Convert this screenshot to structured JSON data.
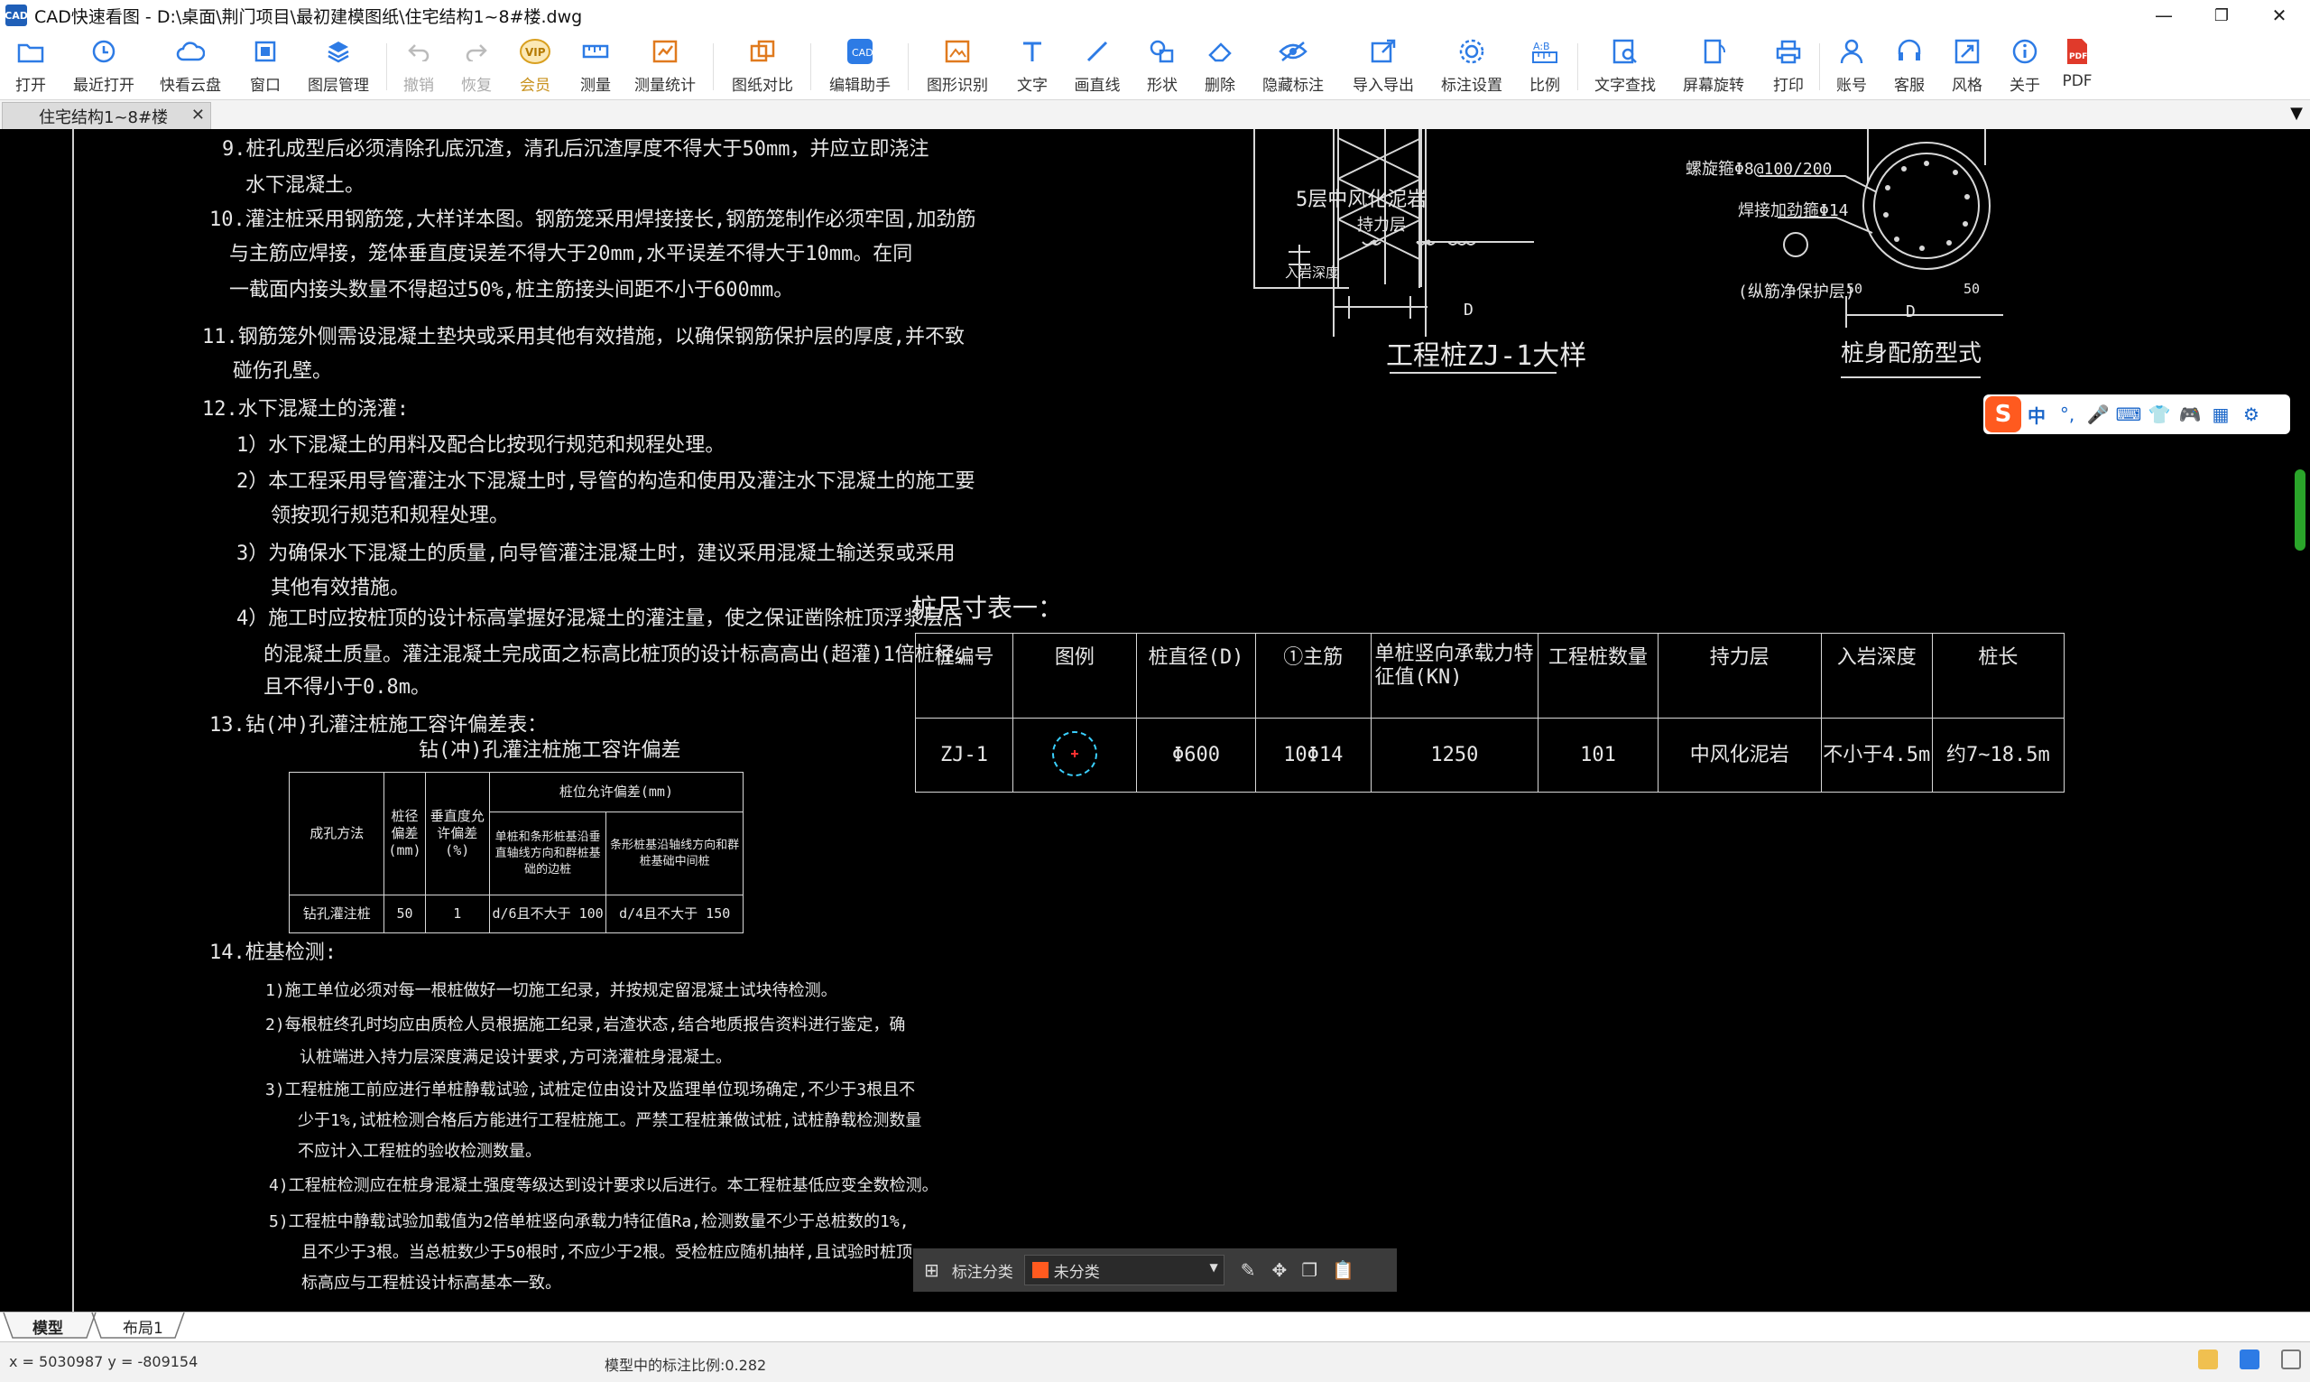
{
  "window": {
    "logo_text": "CAD",
    "title": "CAD快速看图 - D:\\桌面\\荆门项目\\最初建模图纸\\住宅结构1~8#楼.dwg",
    "minimize": "—",
    "maximize": "❐",
    "close": "✕"
  },
  "toolbar": {
    "items": [
      {
        "label": "打开",
        "icon": "folder-open-icon"
      },
      {
        "label": "最近打开",
        "icon": "clock-icon"
      },
      {
        "label": "快看云盘",
        "icon": "cloud-icon"
      },
      {
        "label": "窗口",
        "icon": "window-icon"
      },
      {
        "label": "图层管理",
        "icon": "layers-icon"
      },
      {
        "label": "撤销",
        "icon": "undo-icon",
        "disabled": true
      },
      {
        "label": "恢复",
        "icon": "redo-icon",
        "disabled": true
      },
      {
        "label": "会员",
        "icon": "vip-icon"
      },
      {
        "label": "测量",
        "icon": "ruler-icon"
      },
      {
        "label": "测量统计",
        "icon": "measure-stats-icon"
      },
      {
        "label": "图纸对比",
        "icon": "compare-icon"
      },
      {
        "label": "编辑助手",
        "icon": "edit-assistant-icon"
      },
      {
        "label": "图形识别",
        "icon": "shape-recognize-icon"
      },
      {
        "label": "文字",
        "icon": "text-icon"
      },
      {
        "label": "画直线",
        "icon": "line-icon"
      },
      {
        "label": "形状",
        "icon": "shape-icon"
      },
      {
        "label": "删除",
        "icon": "eraser-icon"
      },
      {
        "label": "隐藏标注",
        "icon": "hide-annotation-icon"
      },
      {
        "label": "导入导出",
        "icon": "import-export-icon"
      },
      {
        "label": "标注设置",
        "icon": "annotation-settings-icon"
      },
      {
        "label": "比例",
        "icon": "scale-icon"
      },
      {
        "label": "文字查找",
        "icon": "text-search-icon"
      },
      {
        "label": "屏幕旋转",
        "icon": "rotate-screen-icon"
      },
      {
        "label": "打印",
        "icon": "printer-icon"
      },
      {
        "label": "账号",
        "icon": "user-icon"
      },
      {
        "label": "客服",
        "icon": "headset-icon"
      },
      {
        "label": "风格",
        "icon": "style-icon"
      },
      {
        "label": "关于",
        "icon": "info-icon"
      },
      {
        "label": "PDF",
        "icon": "pdf-icon"
      }
    ]
  },
  "tabs": {
    "doc_tab": "住宅结构1~8#楼",
    "close": "✕",
    "dropdown": "▼"
  },
  "drawing": {
    "notes": [
      "9.桩孔成型后必须清除孔底沉渣，清孔后沉渣厚度不得大于50mm，并应立即浇注",
      "水下混凝土。",
      "10.灌注桩采用钢筋笼,大样详本图。钢筋笼采用焊接接长,钢筋笼制作必须牢固,加劲筋",
      "与主筋应焊接，笼体垂直度误差不得大于20mm,水平误差不得大于10mm。在同",
      "一截面内接头数量不得超过50%,桩主筋接头间距不小于600mm。",
      "11.钢筋笼外侧需设混凝土垫块或采用其他有效措施，以确保钢筋保护层的厚度,并不致",
      "碰伤孔壁。",
      "12.水下混凝土的浇灌:",
      "1）水下混凝土的用料及配合比按现行规范和规程处理。",
      "2）本工程采用导管灌注水下混凝土时,导管的构造和使用及灌注水下混凝土的施工要",
      "领按现行规范和规程处理。",
      "3）为确保水下混凝土的质量,向导管灌注混凝土时，建议采用混凝土输送泵或采用",
      "其他有效措施。",
      "4）施工时应按桩顶的设计标高掌握好混凝土的灌注量，使之保证凿除桩顶浮浆层后",
      "的混凝土质量。灌注混凝土完成面之标高比桩顶的设计标高高出(超灌)1倍桩径,",
      "且不得小于0.8m。",
      "13.钻(冲)孔灌注桩施工容许偏差表：",
      "钻(冲)孔灌注桩施工容许偏差",
      "14.桩基检测:",
      "1)施工单位必须对每一根桩做好一切施工纪录，并按规定留混凝土试块待检测。",
      "2)每根桩终孔时均应由质检人员根据施工纪录,岩渣状态,结合地质报告资料进行鉴定，确",
      "认桩端进入持力层深度满足设计要求,方可浇灌桩身混凝土。",
      "3)工程桩施工前应进行单桩静载试验,试桩定位由设计及监理单位现场确定,不少于3根且不",
      "少于1%,试桩检测合格后方能进行工程桩施工。严禁工程桩兼做试桩,试桩静载检测数量",
      "不应计入工程桩的验收检测数量。",
      "4)工程桩检测应在桩身混凝土强度等级达到设计要求以后进行。本工程桩基低应变全数检测。",
      "5)工程桩中静载试验加载值为2倍单桩竖向承载力特征值Ra,检测数量不少于总桩数的1%,",
      "且不少于3根。当总桩数少于50根时,不应少于2根。受检桩应随机抽样,且试验时桩顶",
      "标高应与工程桩设计标高基本一致。"
    ],
    "tolerance_table": {
      "headers": [
        "成孔方法",
        "桩径偏差(mm)",
        "垂直度允许偏差(%)",
        "桩位允许偏差(mm)"
      ],
      "subheaders": [
        "单桩和条形桩基沿垂直轴线方向和群桩基础的边桩",
        "条形桩基沿轴线方向和群桩基础中间桩"
      ],
      "row": [
        "钻孔灌注桩",
        "50",
        "1",
        "d/6且不大于 100",
        "d/4且不大于 150"
      ]
    },
    "detail1": {
      "label_layer": "5层中风化泥岩",
      "label_bearing": "持力层",
      "label_depth": "入岩深度",
      "dim": "D",
      "title": "工程桩ZJ-1大样"
    },
    "detail2": {
      "label_spiral": "螺旋箍Φ8@100/200",
      "label_stiffener": "焊接加劲箍Φ14",
      "label_cover": "(纵筋净保护层)",
      "dim_left": "50",
      "dim_right": "50",
      "dim": "D",
      "title": "桩身配筋型式"
    },
    "pile_table": {
      "title": "桩尺寸表一：",
      "headers": [
        "桩编号",
        "图例",
        "桩直径(D)",
        "①主筋",
        "单桩竖向承载力特征值(KN)",
        "工程桩数量",
        "持力层",
        "入岩深度",
        "桩长"
      ],
      "row": [
        "ZJ-1",
        "",
        "Φ600",
        "10Φ14",
        "1250",
        "101",
        "中风化泥岩",
        "不小于4.5m",
        "约7~18.5m"
      ]
    }
  },
  "ime": {
    "logo": "S",
    "items": [
      "中",
      "°,",
      "🎤",
      "⌨",
      "👕",
      "🎮",
      "▦",
      "⚙"
    ]
  },
  "annotation_bar": {
    "label": "标注分类",
    "selected": "未分类"
  },
  "layout_tabs": [
    "模型",
    "布局1"
  ],
  "status": {
    "coords": "x = 5030987  y = -809154",
    "scale_text": "模型中的标注比例:0.282"
  },
  "colors": {
    "canvas": "#000000",
    "cad_text": "#e6e6e6",
    "table_data_green": "#3ad83a",
    "accent_orange": "#ff5a1f"
  }
}
